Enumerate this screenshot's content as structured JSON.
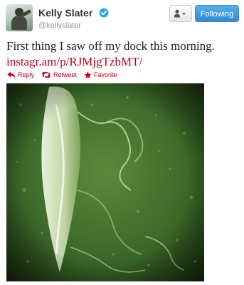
{
  "header": {
    "full_name": "Kelly Slater",
    "screen_name": "@kellyslater",
    "follow_label": "Following",
    "verified_color": "#2fa7e0"
  },
  "tweet": {
    "text": "First thing I saw off my dock this morning.",
    "link": "instagr.am/p/RJMjgTzbMT/",
    "link_color": "#c0001a"
  },
  "actions": {
    "reply_label": "Reply",
    "retweet_label": "Retweet",
    "favorite_label": "Favorite"
  },
  "icons": {
    "verified": "verified-badge-icon",
    "user_menu": "user-dropdown-icon",
    "reply": "reply-arrow-icon",
    "retweet": "retweet-icon",
    "favorite": "star-icon"
  },
  "colors": {
    "follow_button": "#2f8ad2",
    "action_red": "#c0001a",
    "photo_water": "#2f5a22"
  }
}
